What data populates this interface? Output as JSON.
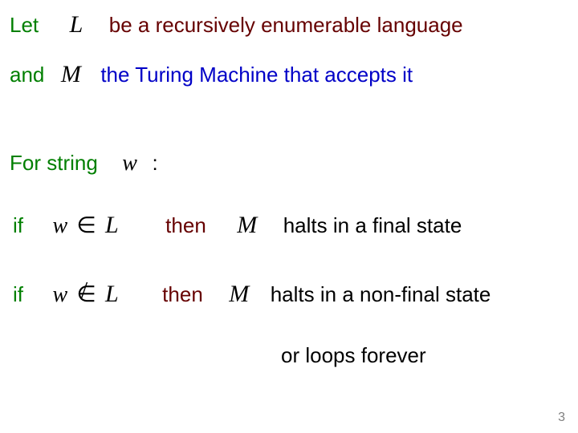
{
  "line1": {
    "let": "Let",
    "var_L": "L",
    "rest": "be a recursively enumerable language"
  },
  "line2": {
    "and": "and",
    "var_M": "M",
    "rest": "the Turing Machine that accepts it"
  },
  "line3": {
    "for_string": "For string",
    "var_w": "w",
    "colon": ":"
  },
  "case1": {
    "if": "if",
    "var_w": "w",
    "in": "∈",
    "var_L": "L",
    "then": "then",
    "var_M": "M",
    "result": "halts in a final state"
  },
  "case2": {
    "if": "if",
    "var_w": "w",
    "in": "∈",
    "slash": "/",
    "var_L": "L",
    "then": "then",
    "var_M": "M",
    "result1": "halts in a non-final state",
    "result2": "or loops forever"
  },
  "page_number": "3"
}
